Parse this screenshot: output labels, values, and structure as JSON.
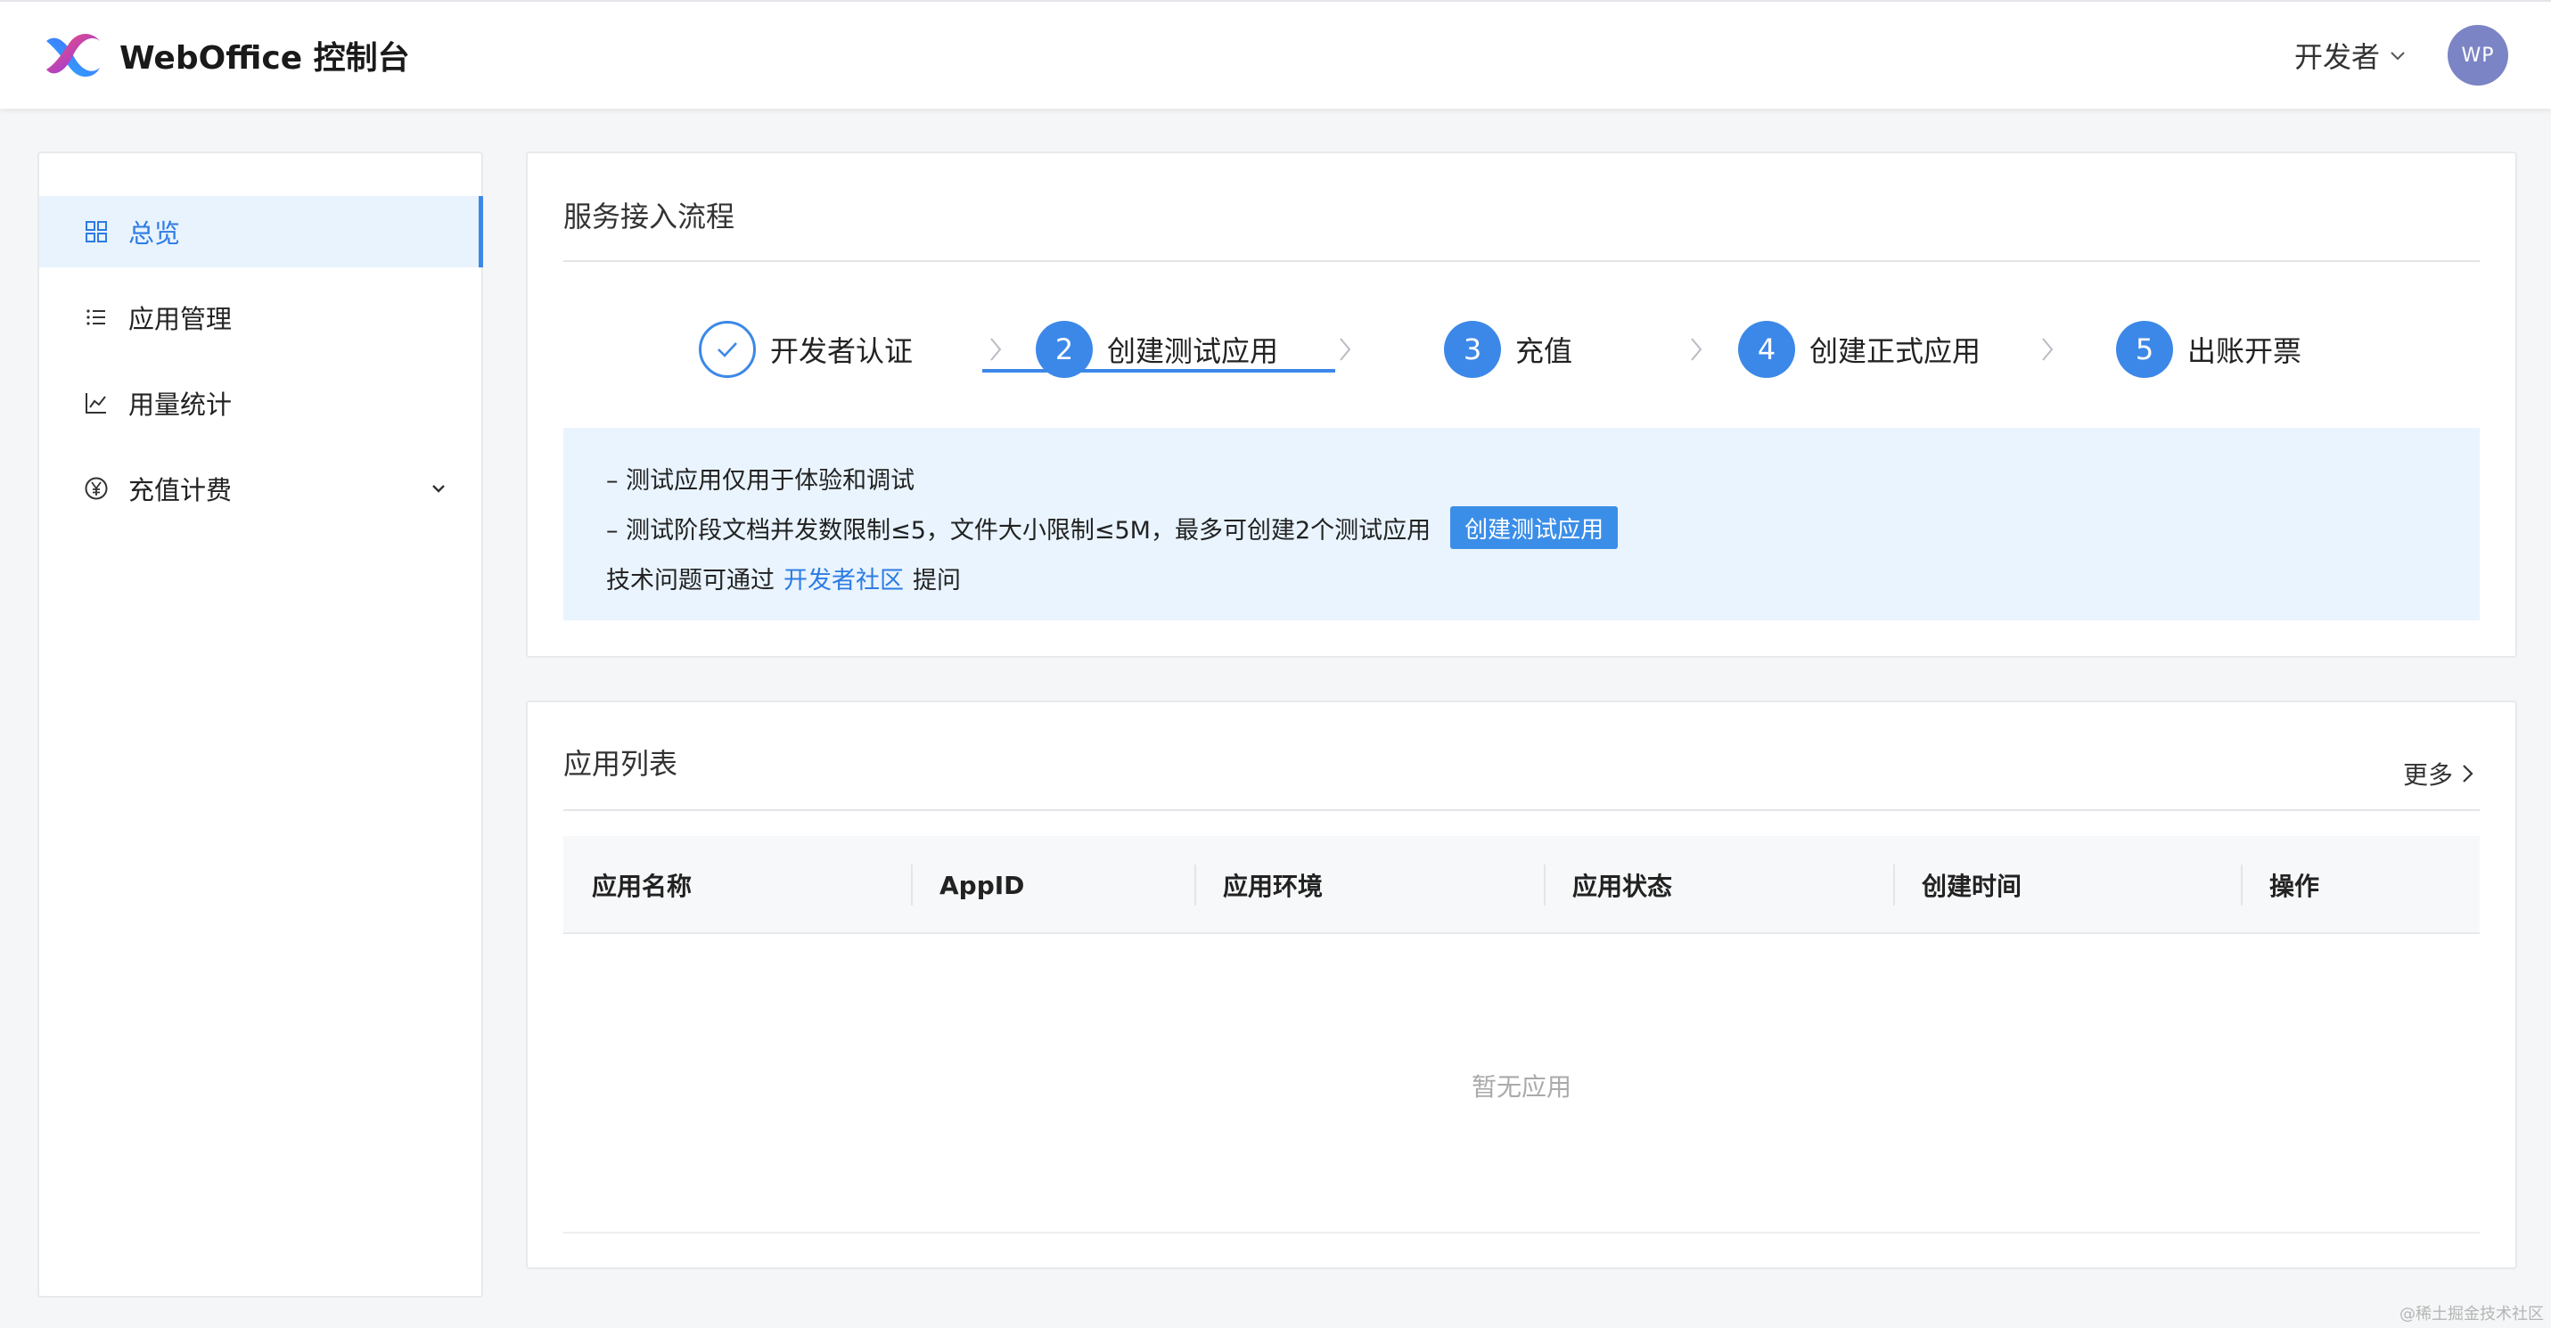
{
  "header": {
    "brand": "WebOffice 控制台",
    "developer_menu": "开发者",
    "avatar_initials": "WP",
    "avatar_color": "#7b84c4"
  },
  "sidebar": {
    "items": [
      {
        "label": "总览",
        "icon": "grid-icon",
        "active": true
      },
      {
        "label": "应用管理",
        "icon": "list-icon"
      },
      {
        "label": "用量统计",
        "icon": "line-chart-icon"
      },
      {
        "label": "充值计费",
        "icon": "yen-icon",
        "expandable": true
      }
    ]
  },
  "process": {
    "title": "服务接入流程",
    "steps": [
      {
        "num": "",
        "label": "开发者认证",
        "status": "done"
      },
      {
        "num": "2",
        "label": "创建测试应用",
        "status": "current"
      },
      {
        "num": "3",
        "label": "充值",
        "status": "pending"
      },
      {
        "num": "4",
        "label": "创建正式应用",
        "status": "pending"
      },
      {
        "num": "5",
        "label": "出账开票",
        "status": "pending"
      }
    ],
    "info": {
      "line1": "– 测试应用仅用于体验和调试",
      "line2": "– 测试阶段文档并发数限制≤5，文件大小限制≤5M，最多可创建2个测试应用",
      "create_button": "创建测试应用",
      "line3_prefix": "技术问题可通过",
      "line3_link": "开发者社区",
      "line3_suffix": "提问"
    }
  },
  "app_list": {
    "title": "应用列表",
    "more": "更多",
    "columns": [
      "应用名称",
      "AppID",
      "应用环境",
      "应用状态",
      "创建时间",
      "操作"
    ],
    "empty_text": "暂无应用"
  },
  "watermark": "@稀土掘金技术社区",
  "colors": {
    "accent": "#3c88e8",
    "active_bg": "#e8f3fe",
    "info_bg": "#e9f4fe"
  }
}
